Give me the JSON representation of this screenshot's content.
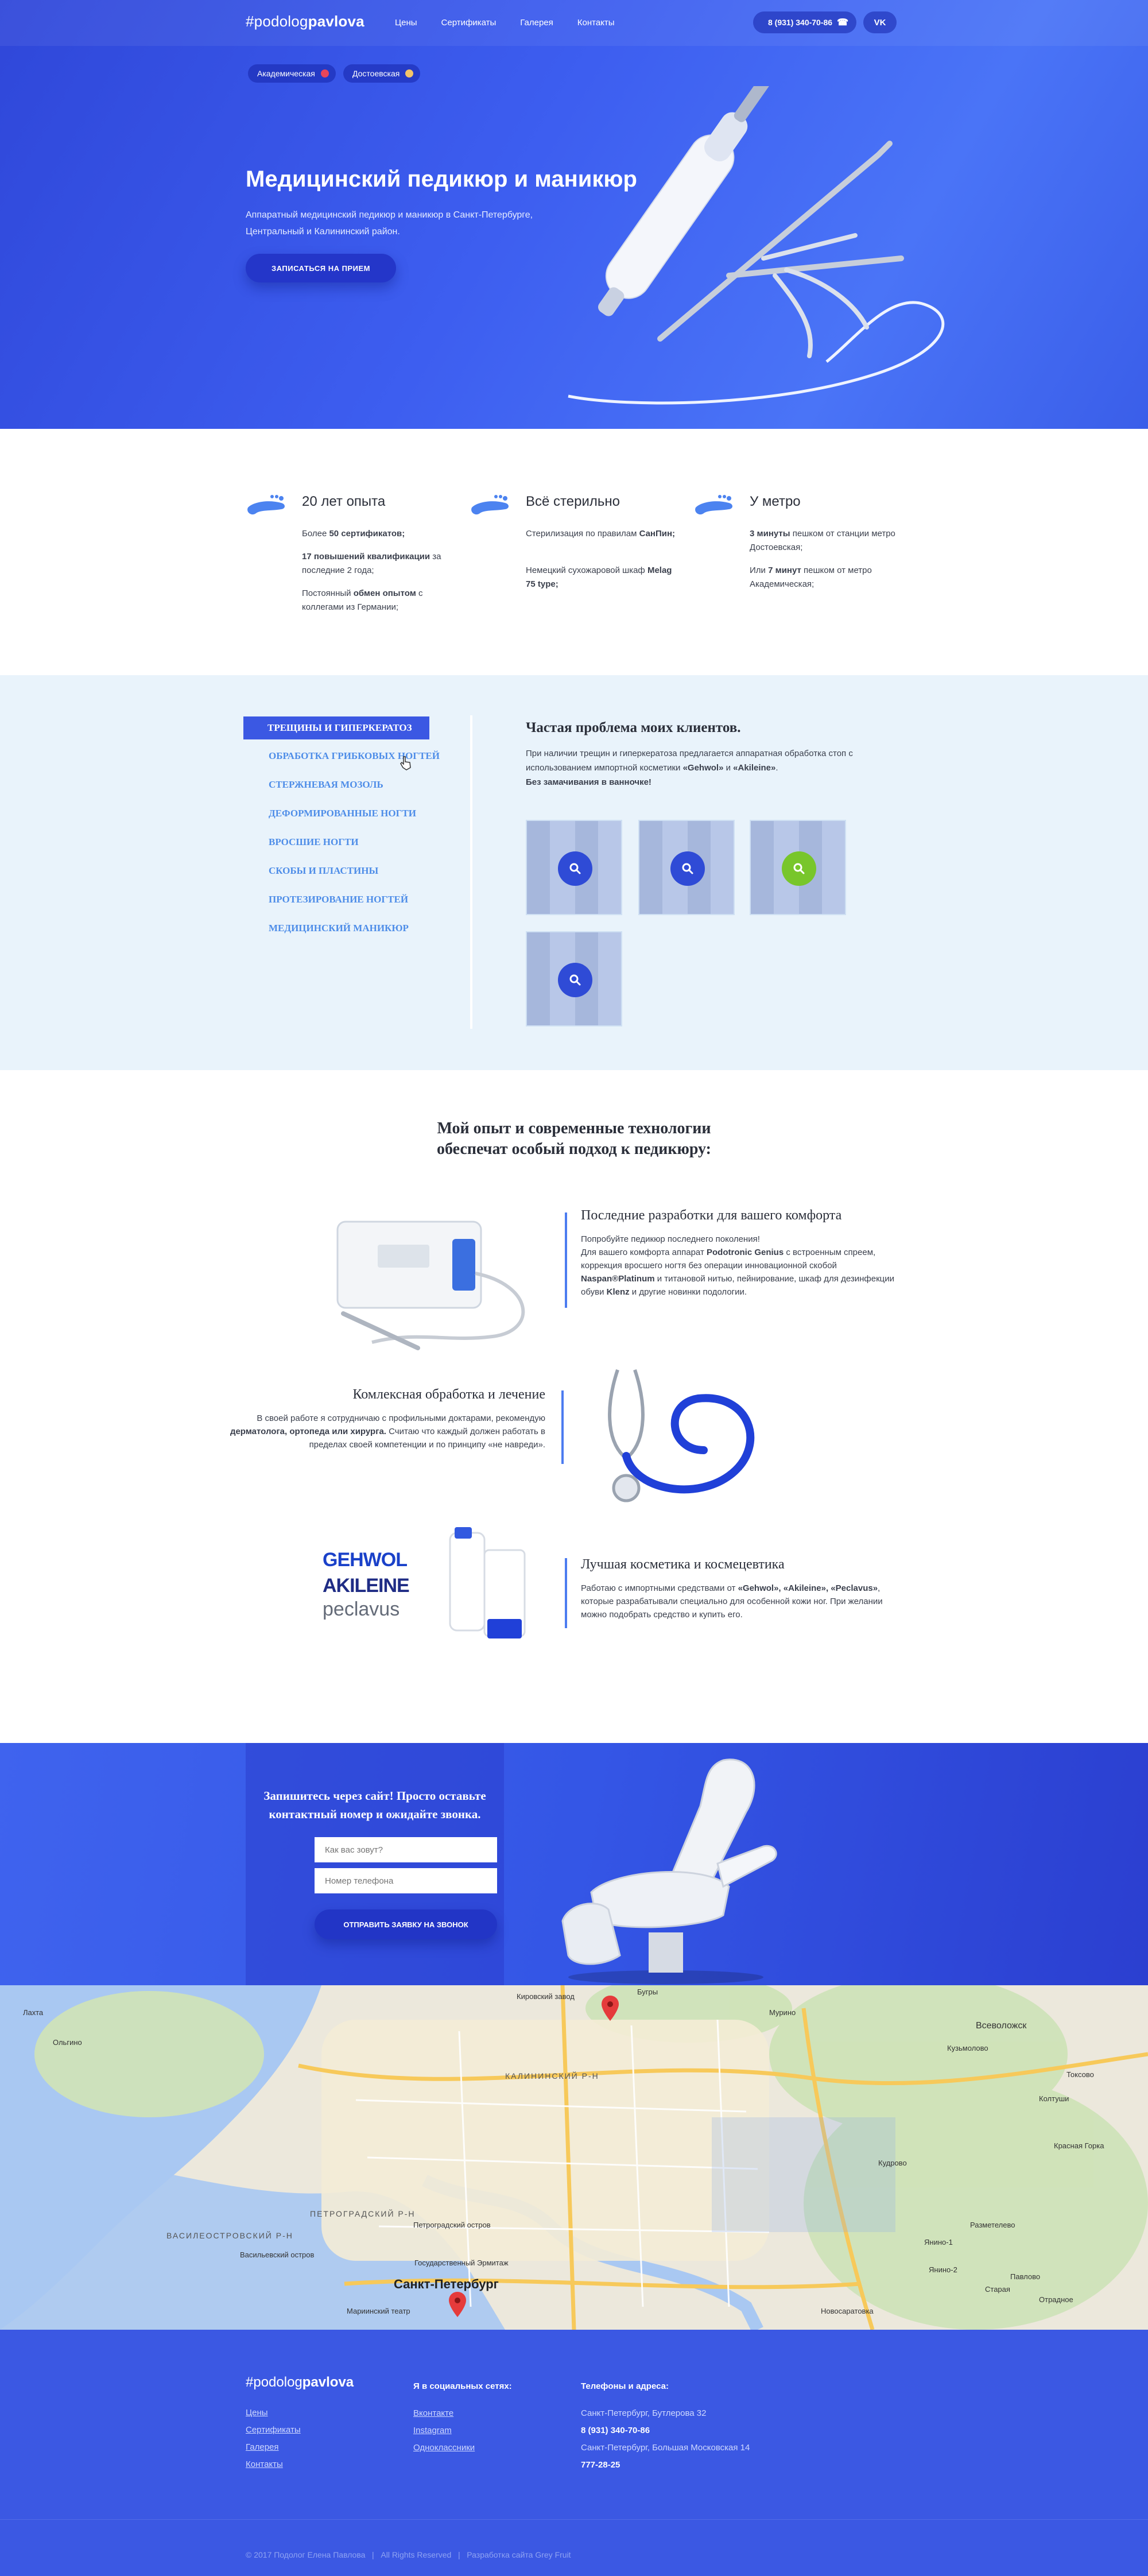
{
  "header": {
    "logo_prefix": "#podolog",
    "logo_bold": "pavlova",
    "nav": [
      "Цены",
      "Сертификаты",
      "Галерея",
      "Контакты"
    ],
    "phone": "8 (931) 340-70-86",
    "vk_label": "VK"
  },
  "metro": [
    {
      "label": "Академическая",
      "color": "#e8465a"
    },
    {
      "label": "Достоевская",
      "color": "#f2c46a"
    }
  ],
  "hero": {
    "title": "Медицинский педикюр и маникюр",
    "subtitle": "Аппаратный медицинский педикюр и маникюр в Санкт-Петербурге, Центральный и Калининский район.",
    "cta": "ЗАПИСАТЬСЯ НА ПРИЕМ"
  },
  "features": [
    {
      "title": "20 лет опыта",
      "p1_pre": "Более ",
      "p1_bold": "50 сертификатов;",
      "p1_post": "",
      "p2_pre": "",
      "p2_bold": "17 повышений квалификации",
      "p2_post": " за последние 2 года;",
      "p3_pre": "Постоянный ",
      "p3_bold": "обмен опытом",
      "p3_post": " с коллегами из Германии;"
    },
    {
      "title": "Всё стерильно",
      "p1_pre": "Стерилизация по правилам ",
      "p1_bold": "СанПин;",
      "p1_post": "",
      "p2_pre": "Немецкий сухожаровой шкаф ",
      "p2_bold": "Melag 75 type;",
      "p2_post": ""
    },
    {
      "title": "У метро",
      "p1_pre": "",
      "p1_bold": "3 минуты",
      "p1_post": " пешком от станции метро Достоевская;",
      "p2_pre": "Или ",
      "p2_bold": "7 минут",
      "p2_post": " пешком от метро Академическая;"
    }
  ],
  "tabs": {
    "items": [
      "ТРЕЩИНЫ И ГИПЕРКЕРАТОЗ",
      "ОБРАБОТКА ГРИБКОВЫХ НОГТЕЙ",
      "СТЕРЖНЕВАЯ МОЗОЛЬ",
      "ДЕФОРМИРОВАННЫЕ НОГТИ",
      "ВРОСШИЕ НОГТИ",
      "СКОБЫ И ПЛАСТИНЫ",
      "ПРОТЕЗИРОВАНИЕ НОГТЕЙ",
      "МЕДИЦИНСКИЙ МАНИКЮР"
    ],
    "problem_title": "Частая проблема моих клиентов.",
    "problem_text_pre": "При наличии трещин и гиперкератоза предлагается аппаратная обработка стоп с использованием импортной косметики ",
    "brand1": "«Gehwol»",
    "mid": " и ",
    "brand2": "«Akileine»",
    "end": ".",
    "bold_line": "Без замачивания в ванночке!"
  },
  "experience": {
    "title_line1": "Мой опыт и современные технологии",
    "title_line2": "обеспечат особый подход к педикюру:",
    "b1_title": "Последние разработки для вашего комфорта",
    "b1_t1": "Попробуйте педикюр последнего поколения!",
    "b1_t2": "Для вашего комфорта аппарат ",
    "b1_b1": "Podotronic Genius",
    "b1_t3": " с встроенным спреем, коррекция вросшего ногтя без операции инновационной скобой ",
    "b1_b2": "Naspan®Platinum",
    "b1_t4": " и титановой нитью, пейнирование, шкаф для дезинфекции обуви ",
    "b1_b3": "Klenz",
    "b1_t5": " и другие новинки подологии.",
    "b2_title": "Комлексная обработка и лечение",
    "b2_t1": "В своей работе я сотрудничаю с профильными доктарами, рекомендую ",
    "b2_b1": "дерматолога, ортопеда или хирурга.",
    "b2_t2": " Считаю что каждый должен работать в пределах своей компетенции и по принципу «не навреди».",
    "b3_title": "Лучшая косметика и космецевтика",
    "b3_t1": "Работаю с импортными средствами от ",
    "b3_b1": "«Gehwol», «Akileine», «Peclavus»",
    "b3_t2": ", которые разрабатывали специально для особенной кожи ног. При желании можно подобрать средство и купить его.",
    "brands": [
      "GEHWOL",
      "AKILEINE",
      "peclavus"
    ]
  },
  "form": {
    "title": "Запишитесь через сайт! Просто оставьте контактный номер и ожидайте звонка.",
    "name_placeholder": "Как вас зовут?",
    "phone_placeholder": "Номер телефона",
    "button": "ОТПРАВИТЬ ЗАЯВКУ НА ЗВОНОК"
  },
  "map": {
    "labels": [
      "Ольгино",
      "Лахта",
      "Мурино",
      "Всеволожск",
      "Кудрово",
      "Кузьмолово",
      "Колтуши",
      "Янино-1",
      "Янино-2",
      "Красная Горка",
      "Разметелево",
      "Новосаратовка",
      "Отрадное",
      "Старая",
      "Бугры",
      "Петроградский остров",
      "Васильевский остров",
      "Мариинский театр",
      "Государственный Эрмитаж",
      "Кировский завод",
      "Токсово",
      "Павлово"
    ],
    "districts": [
      "КАЛИНИНСКИЙ Р-Н",
      "ВАСИЛЕОСТРОВСКИЙ Р-Н",
      "ПЕТРОГРАДСКИЙ Р-Н"
    ],
    "city": "Санкт-Петербург"
  },
  "footer": {
    "logo_prefix": "#podolog",
    "logo_bold": "pavlova",
    "links": [
      "Цены",
      "Сертификаты",
      "Галерея",
      "Контакты"
    ],
    "social_title": "Я в социальных сетях:",
    "social": [
      "Вконтакте",
      "Instagram",
      "Одноклассники"
    ],
    "contacts_title": "Телефоны и адреса:",
    "addr1": "Санкт-Петербург, Бутлерова 32",
    "phone1": "8 (931) 340-70-86",
    "addr2": "Санкт-Петербург, Большая Московская 14",
    "phone2": "777-28-25",
    "copyright": "© 2017 Подолог Елена Павлова",
    "rights": "All Rights Reserved",
    "dev": "Разработка сайта Grey Fruit"
  }
}
